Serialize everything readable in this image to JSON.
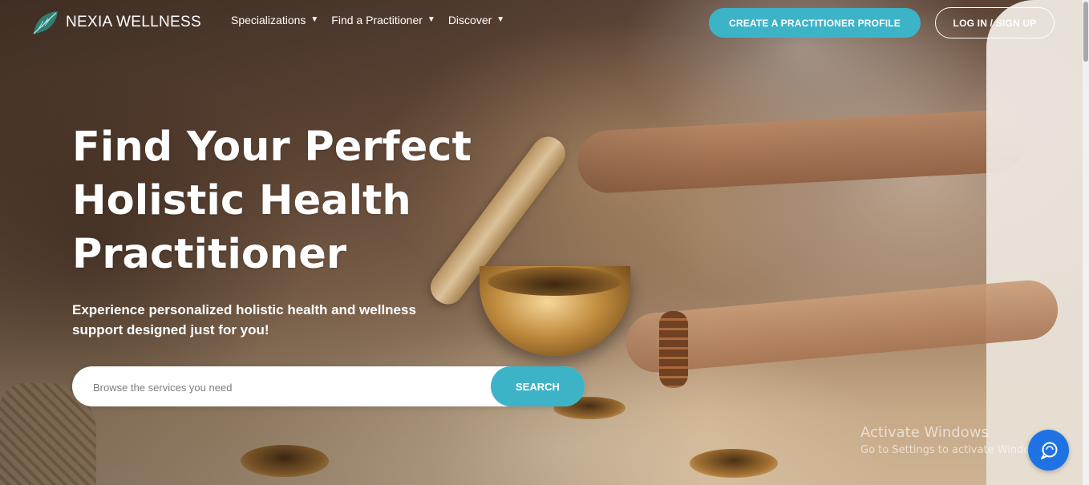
{
  "brand": {
    "name": "NEXIA WELLNESS",
    "logo_icon": "leaf-logo-icon",
    "accent_color": "#3db3c8"
  },
  "nav": {
    "items": [
      {
        "label": "Specializations",
        "icon": "caret-down-icon"
      },
      {
        "label": "Find a Practitioner",
        "icon": "caret-down-icon"
      },
      {
        "label": "Discover",
        "icon": "caret-down-icon"
      }
    ],
    "caret": "▼"
  },
  "header_actions": {
    "create_profile_label": "CREATE A PRACTITIONER PROFILE",
    "login_label": "LOG IN / SIGN UP"
  },
  "hero": {
    "title_lines": [
      "Find Your Perfect",
      "Holistic Health",
      "Practitioner"
    ],
    "subtitle_lines": [
      "Experience personalized holistic health and wellness",
      "support designed just for you!"
    ]
  },
  "search": {
    "placeholder": "Browse the services you need",
    "value": "",
    "button_label": "SEARCH"
  },
  "watermark": {
    "title": "Activate Windows",
    "subtitle": "Go to Settings to activate Windows."
  },
  "chat": {
    "icon": "chat-support-icon",
    "color": "#1e72e4"
  }
}
